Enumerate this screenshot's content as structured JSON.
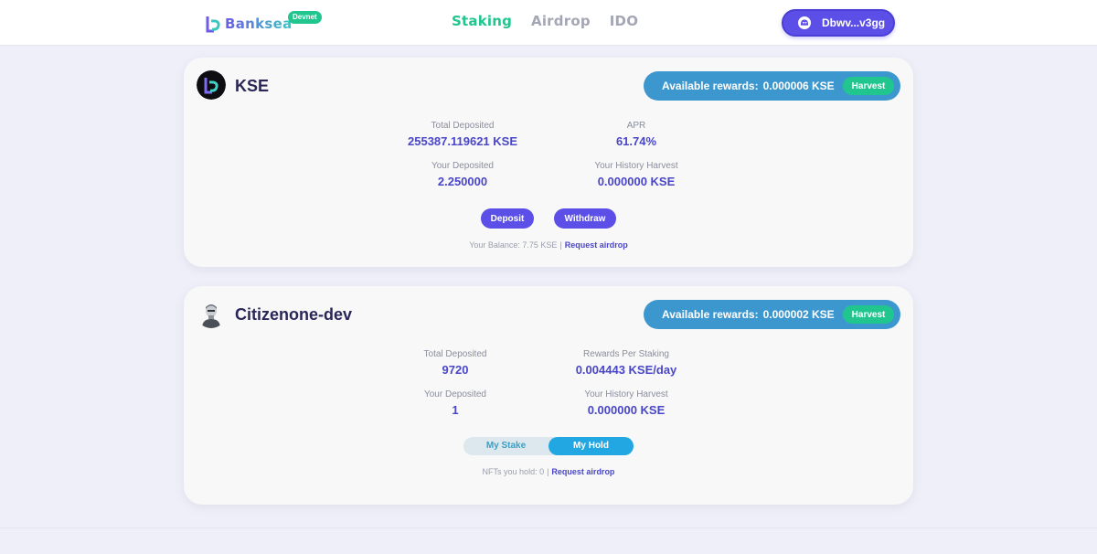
{
  "header": {
    "logo_text": "Banksea",
    "network_badge": "Devnet",
    "nav": [
      {
        "label": "Staking",
        "active": true
      },
      {
        "label": "Airdrop",
        "active": false
      },
      {
        "label": "IDO",
        "active": false
      }
    ],
    "wallet": {
      "label": "Dbwv...v3gg",
      "icon": "phantom-ghost-icon"
    }
  },
  "pools": [
    {
      "name": "KSE",
      "avatar_icon": "kse-token-icon",
      "rewards_label": "Available rewards:",
      "rewards_value": "0.000006 KSE",
      "harvest_label": "Harvest",
      "stats": {
        "total_deposited_label": "Total Deposited",
        "total_deposited": "255387.119621 KSE",
        "apr_label": "APR",
        "apr": "61.74%",
        "your_deposited_label": "Your Deposited",
        "your_deposited": "2.250000",
        "history_harvest_label": "Your History Harvest",
        "history_harvest": "0.000000 KSE"
      },
      "deposit_label": "Deposit",
      "withdraw_label": "Withdraw",
      "balance_text": "Your Balance: 7.75 KSE",
      "separator": "|",
      "airdrop_link": "Request airdrop"
    },
    {
      "name": "Citizenone-dev",
      "avatar_icon": "citizen-nft-avatar-icon",
      "rewards_label": "Available rewards:",
      "rewards_value": "0.000002 KSE",
      "harvest_label": "Harvest",
      "stats": {
        "total_deposited_label": "Total Deposited",
        "total_deposited": "9720",
        "rewards_per_staking_label": "Rewards Per Staking",
        "rewards_per_staking": "0.004443 KSE/day",
        "your_deposited_label": "Your Deposited",
        "your_deposited": "1",
        "history_harvest_label": "Your History Harvest",
        "history_harvest": "0.000000 KSE"
      },
      "tabs": [
        {
          "label": "My Stake",
          "active": false
        },
        {
          "label": "My Hold",
          "active": true
        }
      ],
      "hold_text": "NFTs you hold: 0",
      "separator": "|",
      "airdrop_link": "Request airdrop"
    }
  ],
  "colors": {
    "accent": "#5b4fe8",
    "green": "#21c58e",
    "rewards_blue": "#3d97cf",
    "value_text": "#4a46c8",
    "background": "#eeeff8"
  }
}
